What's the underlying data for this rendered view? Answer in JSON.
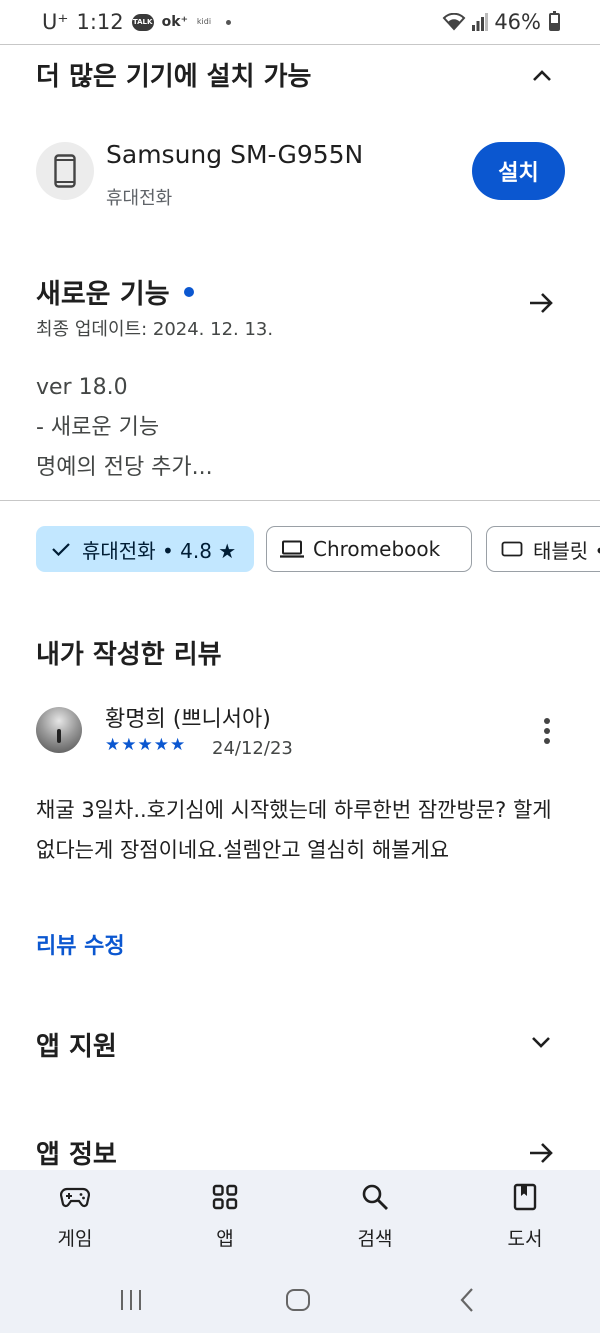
{
  "status_bar": {
    "carrier": "U⁺",
    "time": "1:12",
    "notif_talk": "TALK",
    "notif_ok": "ok⁺",
    "notif_kidi": "kidi",
    "battery": "46%",
    "battery_level": 0.46
  },
  "more_devices": {
    "title": "더 많은 기기에 설치 가능",
    "device_name": "Samsung SM-G955N",
    "device_type": "휴대전화",
    "install_label": "설치"
  },
  "whats_new": {
    "title": "새로운 기능",
    "updated": "최종 업데이트: 2024. 12. 13.",
    "lines": [
      "ver 18.0",
      "- 새로운 기능",
      "명예의 전당 추가..."
    ]
  },
  "device_chips": [
    {
      "label": "휴대전화 • 4.8 ★",
      "icon": "check-icon",
      "selected": true
    },
    {
      "label": "Chromebook",
      "icon": "laptop-icon",
      "selected": false
    },
    {
      "label": "태블릿 •",
      "icon": "tablet-icon",
      "selected": false
    }
  ],
  "my_review": {
    "title": "내가 작성한 리뷰",
    "reviewer": "황명희 (쁘니서아)",
    "stars": "★★★★★",
    "rating": 5,
    "date": "24/12/23",
    "body": "채굴 3일차..호기심에 시작했는데 하루한번 잠깐방문? 할게 없다는게 장점이네요.설렘안고 열심히 해볼게요",
    "edit_label": "리뷰 수정"
  },
  "app_support": {
    "title": "앱 지원"
  },
  "app_info": {
    "title": "앱 정보"
  },
  "bottom_nav": [
    {
      "label": "게임",
      "icon": "gamepad-icon"
    },
    {
      "label": "앱",
      "icon": "apps-grid-icon"
    },
    {
      "label": "검색",
      "icon": "search-icon"
    },
    {
      "label": "도서",
      "icon": "book-icon"
    }
  ],
  "colors": {
    "accent": "#0b57d0",
    "chip_selected": "#c2e7ff",
    "nav_bg": "#eef1f7"
  }
}
